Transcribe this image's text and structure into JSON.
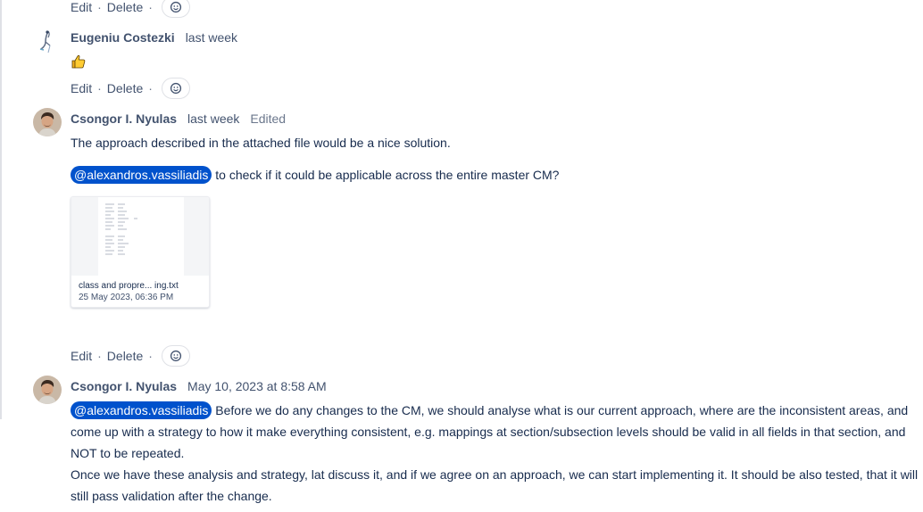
{
  "actions": {
    "edit": "Edit",
    "delete": "Delete",
    "sep": "·"
  },
  "comments": [
    {
      "author": "Eugeniu Costezki",
      "time": "last week",
      "body_emoji": "thumbs-up"
    },
    {
      "author": "Csongor I. Nyulas",
      "time": "last week",
      "edited": "Edited",
      "line1": "The approach described in the attached file would be a nice solution.",
      "mention": "@alexandros.vassiliadis",
      "line2": " to check if it could be applicable across the entire master CM?",
      "attachment": {
        "name": "class and propre... ing.txt",
        "date": "25 May 2023, 06:36 PM"
      }
    },
    {
      "author": "Csongor I. Nyulas",
      "time": "May 10, 2023 at 8:58 AM",
      "mention": "@alexandros.vassiliadis",
      "para1_a": " Before we do any changes to the CM, we should analyse what is our current approach, where are the inconsistent areas, and",
      "para1_b": "come up with a strategy to how it make everything consistent, e.g. mappings at section/subsection levels should be valid in all fields in that section, and",
      "para1_c": "NOT to be repeated.",
      "para2_a": "Once we have these analysis and strategy, lat discuss it, and if we agree on an approach, we can start implementing it. It should be also tested, that it will",
      "para2_b": "still pass validation after the change."
    }
  ],
  "colors": {
    "mention_bg": "#0052cc",
    "text": "#172b4d",
    "meta": "#42526e"
  },
  "icons": {
    "reaction": "add-reaction-icon",
    "like": "thumbs-up-icon"
  }
}
